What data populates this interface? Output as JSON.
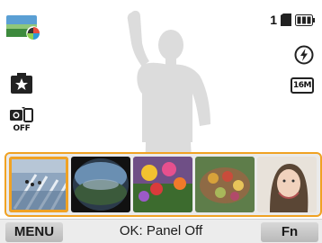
{
  "status": {
    "shot_count": "1",
    "flash": "flash-auto-icon",
    "image_size": "16M",
    "battery": "battery-full-icon",
    "card": "memory-card-icon"
  },
  "left_icons": {
    "mode": "scene-mode-thumbnail-icon",
    "smart": "smart-auto-icon",
    "mirror": "self-shot-off-icon",
    "mirror_label": "OFF"
  },
  "filters": [
    {
      "name": "miniature",
      "selected": true
    },
    {
      "name": "fisheye",
      "selected": false
    },
    {
      "name": "vivid-flowers",
      "selected": false
    },
    {
      "name": "oil-paint",
      "selected": false
    },
    {
      "name": "sketch-portrait",
      "selected": false
    }
  ],
  "bottom_bar": {
    "menu_label": "MENU",
    "ok_text": "OK: Panel Off",
    "fn_label": "Fn"
  },
  "colors": {
    "accent": "#f0a224",
    "silhouette": "#dcdcdc"
  }
}
